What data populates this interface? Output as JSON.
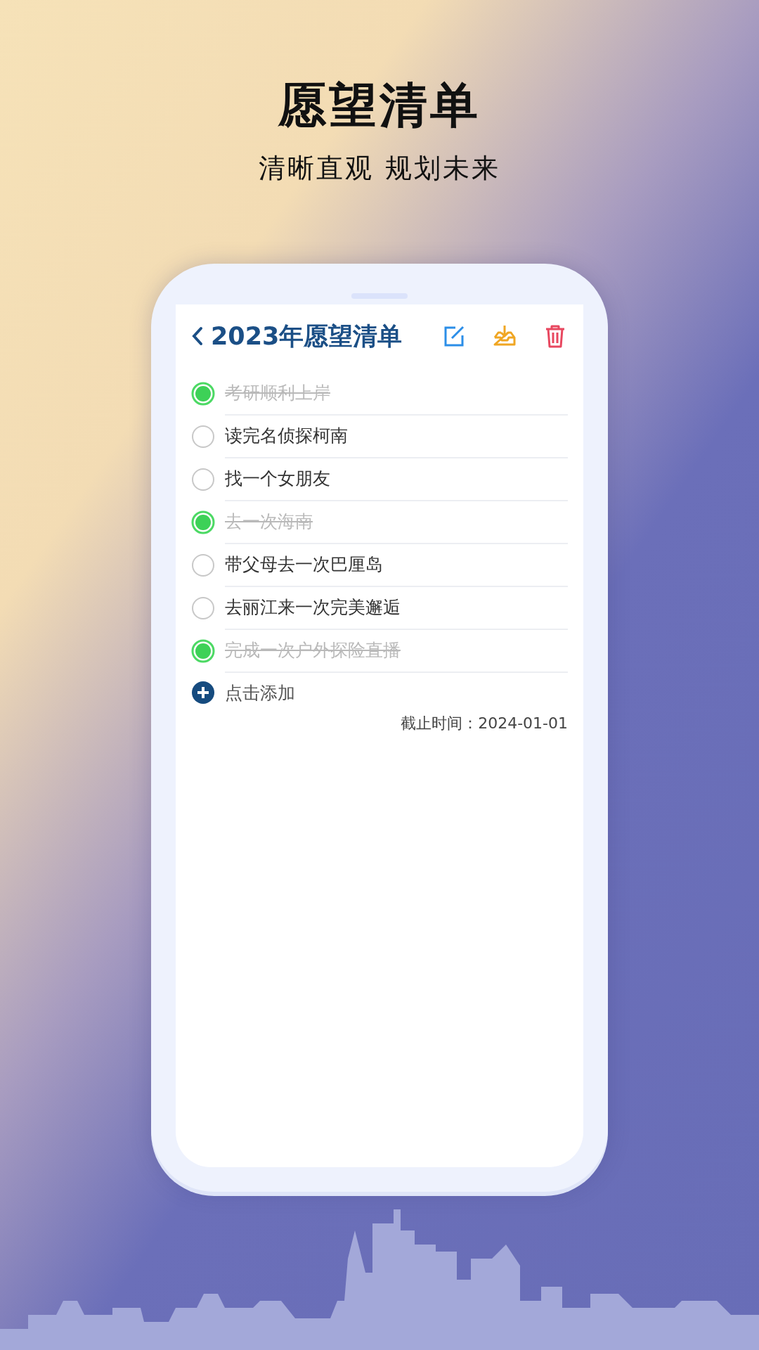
{
  "headline": "愿望清单",
  "subtitle": "清晰直观 规划未来",
  "app": {
    "title": "2023年愿望清单",
    "items": [
      {
        "text": "考研顺利上岸",
        "checked": true
      },
      {
        "text": "读完名侦探柯南",
        "checked": false
      },
      {
        "text": "找一个女朋友",
        "checked": false
      },
      {
        "text": "去一次海南",
        "checked": true
      },
      {
        "text": "带父母去一次巴厘岛",
        "checked": false
      },
      {
        "text": "去丽江来一次完美邂逅",
        "checked": false
      },
      {
        "text": "完成一次户外探险直播",
        "checked": true
      }
    ],
    "add_label": "点击添加",
    "deadline": "截止时间：2024-01-01"
  }
}
